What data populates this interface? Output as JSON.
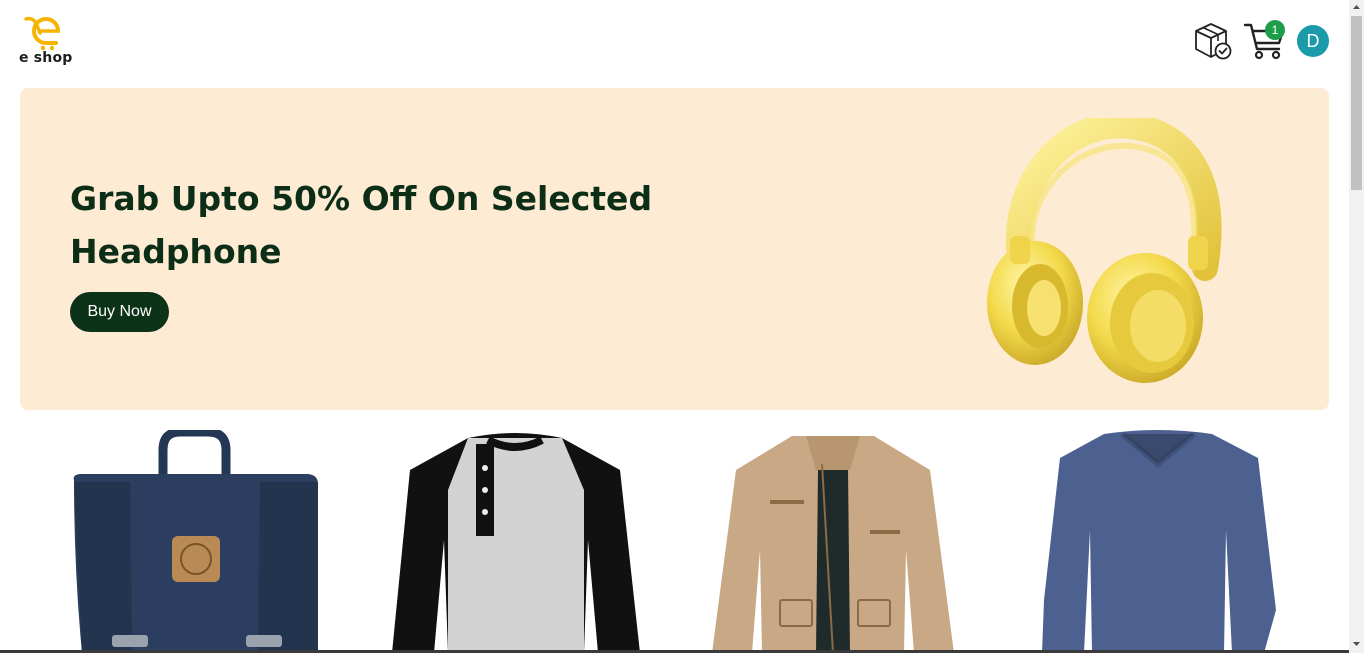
{
  "brand": {
    "name": "e shop",
    "accent_color": "#f5b400"
  },
  "header": {
    "orders_icon": "package-check-icon",
    "cart_icon": "shopping-cart-icon",
    "cart_count": "1",
    "avatar_initial": "D",
    "avatar_color": "#1b9aaa",
    "badge_color": "#1e9e4a"
  },
  "hero": {
    "title": "Grab Upto 50% Off On Selected Headphone",
    "button_label": "Buy Now",
    "background_color": "#fdebd4",
    "image": "yellow-headphones-image"
  },
  "products": [
    {
      "image": "navy-backpack-image"
    },
    {
      "image": "raglan-henley-shirt-image"
    },
    {
      "image": "khaki-jacket-image"
    },
    {
      "image": "blue-v-neck-sweater-image"
    }
  ]
}
